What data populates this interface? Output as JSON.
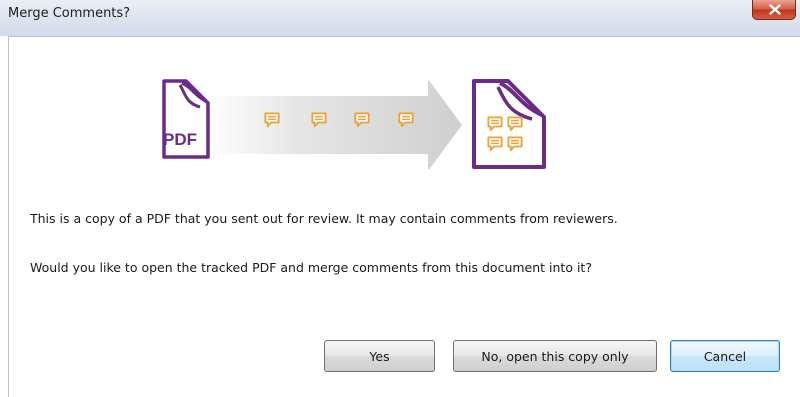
{
  "window": {
    "title": "Merge Comments?"
  },
  "graphic": {
    "source_label": "PDF"
  },
  "messages": {
    "line1": "This is a copy of a PDF that you sent out for review. It may contain comments from reviewers.",
    "line2": "Would you like to open the tracked PDF and merge comments from this document into it?"
  },
  "buttons": {
    "yes": "Yes",
    "no_copy_only": "No, open this copy only",
    "cancel": "Cancel"
  },
  "colors": {
    "purple": "#6a2c86",
    "comment_orange": "#f0a030"
  },
  "icons": [
    "close-icon",
    "pdf-file-icon",
    "comment-icon",
    "merged-document-icon",
    "arrow-icon"
  ]
}
